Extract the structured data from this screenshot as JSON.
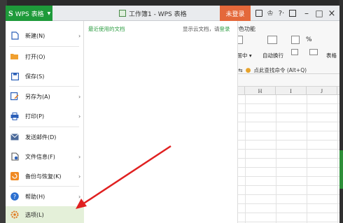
{
  "titlebar": {
    "app_button": "WPS 表格",
    "app_letter": "S",
    "doc_title": "工作簿1 - WPS 表格",
    "login_label": "未登录",
    "help_label": "?·",
    "min_label": "–",
    "max_label": "□",
    "close_label": "×"
  },
  "menu": {
    "items": [
      {
        "label": "新建(N)",
        "icon": "new-file-icon",
        "has_arrow": true
      },
      {
        "label": "打开(O)",
        "icon": "open-folder-icon",
        "has_arrow": false
      },
      {
        "label": "保存(S)",
        "icon": "save-icon",
        "has_arrow": false
      },
      {
        "label": "另存为(A)",
        "icon": "save-as-icon",
        "has_arrow": true
      },
      {
        "label": "打印(P)",
        "icon": "print-icon",
        "has_arrow": true
      },
      {
        "label": "发送邮件(D)",
        "icon": "mail-icon",
        "has_arrow": false
      },
      {
        "label": "文件信息(F)",
        "icon": "file-info-icon",
        "has_arrow": true
      },
      {
        "label": "备份与恢复(K)",
        "icon": "backup-icon",
        "has_arrow": true
      },
      {
        "label": "帮助(H)",
        "icon": "help-icon",
        "has_arrow": true
      },
      {
        "label": "选项(L)",
        "icon": "options-gear-icon",
        "has_arrow": false
      }
    ],
    "selected": "选项(L)"
  },
  "recent": {
    "title": "最近使用的文档",
    "cloud_prefix": "显示云文档，请",
    "cloud_link": "登录"
  },
  "ribbon": {
    "tab_special": "特色功能",
    "merge_center": "并居中",
    "wrap_text": "自动换行",
    "percent": "%",
    "table_style": "表格",
    "find_command": "点此查找命令 (Alt+Q)"
  },
  "grid": {
    "columns": [
      "H",
      "I",
      "J"
    ]
  },
  "colors": {
    "wps_green": "#1e9a3a",
    "login_orange": "#e4683a",
    "selected_bg": "#e4f0d9",
    "arrow_red": "#e02020"
  }
}
